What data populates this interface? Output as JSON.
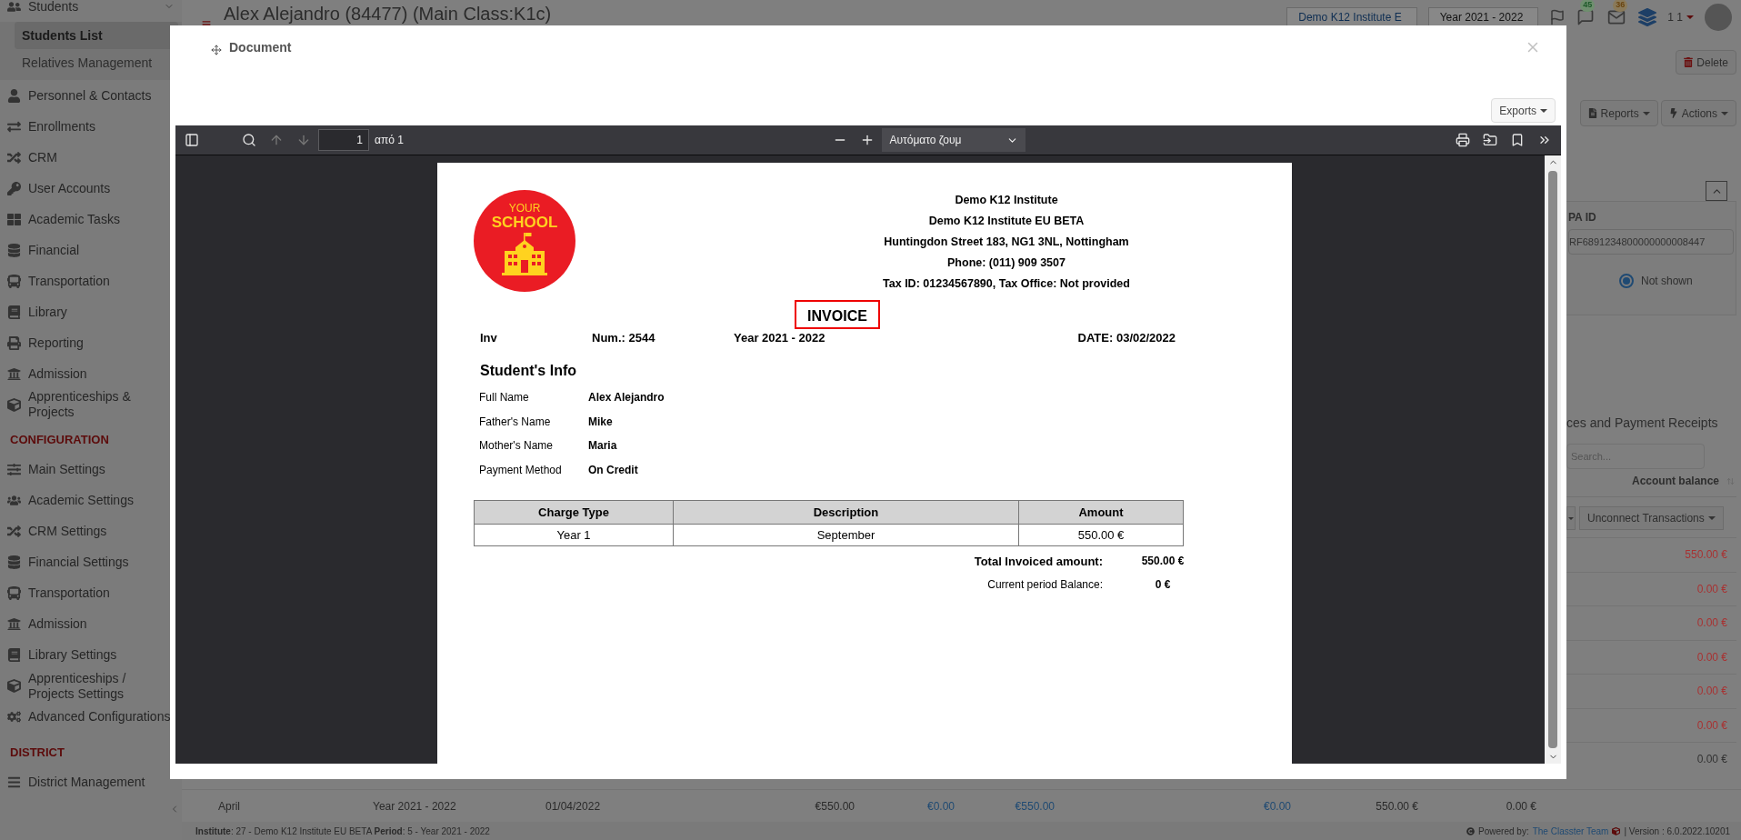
{
  "sidebar": {
    "groups": [
      {
        "items": [
          {
            "label": "Students",
            "selected": false,
            "expanded": true,
            "children": [
              {
                "label": "Students List",
                "selected": true
              },
              {
                "label": "Relatives Management",
                "selected": false
              }
            ]
          },
          {
            "label": "Personnel & Contacts",
            "selected": false
          },
          {
            "label": "Enrollments",
            "selected": false
          },
          {
            "label": "CRM",
            "selected": false
          },
          {
            "label": "User Accounts",
            "selected": false
          },
          {
            "label": "Academic Tasks",
            "selected": false
          },
          {
            "label": "Financial",
            "selected": false
          },
          {
            "label": "Transportation",
            "selected": false
          },
          {
            "label": "Library",
            "selected": false
          },
          {
            "label": "Reporting",
            "selected": false
          },
          {
            "label": "Admission",
            "selected": false
          },
          {
            "label": "Apprenticeships & Projects",
            "selected": false
          }
        ]
      },
      {
        "heading": "CONFIGURATION",
        "items": [
          {
            "label": "Main Settings",
            "selected": false
          },
          {
            "label": "Academic Settings",
            "selected": false
          },
          {
            "label": "CRM Settings",
            "selected": false
          },
          {
            "label": "Financial Settings",
            "selected": false
          },
          {
            "label": "Transportation",
            "selected": false
          },
          {
            "label": "Admission",
            "selected": false
          },
          {
            "label": "Library Settings",
            "selected": false
          },
          {
            "label": "Apprenticeships / Projects Settings",
            "selected": false
          },
          {
            "label": "Advanced Configurations",
            "selected": false
          }
        ]
      },
      {
        "heading": "DISTRICT",
        "items": [
          {
            "label": "District Management",
            "selected": false
          }
        ]
      }
    ]
  },
  "header": {
    "title": "Alex Alejandro (84477) (Main Class:K1c)",
    "institute": "Demo K12 Institute E",
    "year": "Year 2021 - 2022",
    "chat_badge": "45",
    "mail_badge": "36",
    "user": "1 1"
  },
  "right_panel": {
    "delete": "Delete",
    "reports": "Reports",
    "actions": "Actions",
    "field_label": "PA ID",
    "field_value": "RF6891234800000000008447",
    "radio": {
      "label": "Not shown",
      "selected": true
    },
    "section_title": "ces and Payment Receipts",
    "search_placeholder": "Search...",
    "balance_heading": "Account balance",
    "unconnect": "Unconnect Transactions",
    "balances": [
      {
        "value": "550.00 €",
        "color": "#a83232"
      },
      {
        "value": "0.00 €",
        "color": "#a83232"
      },
      {
        "value": "0.00 €",
        "color": "#a83232"
      },
      {
        "value": "0.00 €",
        "color": "#a83232"
      },
      {
        "value": "0.00 €",
        "color": "#a83232"
      },
      {
        "value": "0.00 €",
        "color": "#a83232"
      },
      {
        "value": "0.00 €",
        "color": "#333333"
      }
    ]
  },
  "bottom_row": {
    "cells": [
      {
        "text": "April",
        "kind": "plain"
      },
      {
        "text": "Year 2021 - 2022",
        "kind": "plain"
      },
      {
        "text": "01/04/2022",
        "kind": "plain"
      },
      {
        "text": "€550.00",
        "kind": "plain"
      },
      {
        "text": "€0.00",
        "kind": "link"
      },
      {
        "text": "€550.00",
        "kind": "link"
      },
      {
        "text": "€0.00",
        "kind": "link"
      },
      {
        "text": "550.00 €",
        "kind": "plain"
      },
      {
        "text": "0.00 €",
        "kind": "plain"
      }
    ]
  },
  "status_bar": {
    "institute_label": "Institute",
    "institute": ": 27 - Demo K12 Institute EU BETA",
    "period_label": "Period",
    "period": ": 5 - Year 2021 - 2022",
    "powered": "Powered by:",
    "team": "The Classter Team",
    "version": "| Version : 6.0.2022.10201"
  },
  "dialog": {
    "title": "Document",
    "exports": "Exports",
    "viewer": {
      "page": "1",
      "page_count": "από 1",
      "zoom": "Αυτόματο ζουμ"
    },
    "invoice": {
      "logo": {
        "line1": "YOUR",
        "line2": "SCHOOL"
      },
      "institute_lines": [
        "Demo K12 Institute",
        "Demo K12 Institute EU BETA",
        "Huntingdon Street 183, NG1 3NL, Nottingham",
        "Phone: (011) 909 3507",
        "Tax ID: 01234567890, Tax Office: Not provided"
      ],
      "heading": "INVOICE",
      "meta": [
        "Inv",
        "Num.: 2544",
        "Year 2021 - 2022",
        "DATE: 03/02/2022"
      ],
      "student_info_title": "Student's Info",
      "fields": [
        {
          "label": "Full Name",
          "value": "Alex Alejandro"
        },
        {
          "label": "Father's Name",
          "value": "Mike"
        },
        {
          "label": "Mother's Name",
          "value": "Maria"
        },
        {
          "label": "Payment Method",
          "value": "On Credit"
        }
      ],
      "table": {
        "columns": [
          "Charge Type",
          "Description",
          "Amount"
        ],
        "rows": [
          [
            "Year 1",
            "September",
            "550.00 €"
          ]
        ]
      },
      "totals": [
        {
          "label": "Total Invoiced amount:",
          "value": "550.00 €",
          "bold": true
        },
        {
          "label": "Current period Balance:",
          "value": "0 €",
          "bold": false
        }
      ]
    }
  }
}
